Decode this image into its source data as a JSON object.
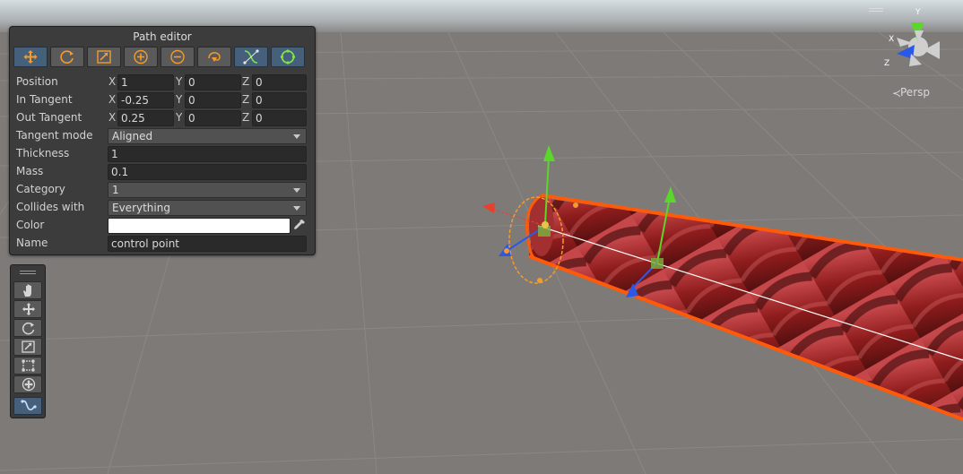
{
  "panel": {
    "title": "Path editor",
    "tools": [
      {
        "icon": "move-icon",
        "active": true
      },
      {
        "icon": "rotate-icon",
        "active": false
      },
      {
        "icon": "scale-icon",
        "active": false
      },
      {
        "icon": "add-point-icon",
        "active": false
      },
      {
        "icon": "remove-point-icon",
        "active": false
      },
      {
        "icon": "orient-icon",
        "active": false
      },
      {
        "icon": "tangent-icon",
        "active": true
      },
      {
        "icon": "thickness-icon",
        "active": true
      }
    ],
    "position": {
      "label": "Position",
      "x": "1",
      "y": "0",
      "z": "0"
    },
    "in_tangent": {
      "label": "In Tangent",
      "x": "-0.25",
      "y": "0",
      "z": "0"
    },
    "out_tangent": {
      "label": "Out Tangent",
      "x": "0.25",
      "y": "0",
      "z": "0"
    },
    "axis_labels": {
      "x": "X",
      "y": "Y",
      "z": "Z"
    },
    "tangent_mode": {
      "label": "Tangent mode",
      "value": "Aligned"
    },
    "thickness": {
      "label": "Thickness",
      "value": "1"
    },
    "mass": {
      "label": "Mass",
      "value": "0.1"
    },
    "category": {
      "label": "Category",
      "value": "1"
    },
    "collides_with": {
      "label": "Collides with",
      "value": "Everything"
    },
    "color": {
      "label": "Color",
      "value": "#ffffff"
    },
    "name": {
      "label": "Name",
      "value": "control point"
    }
  },
  "tools_overlay": [
    "hand-icon",
    "move-icon",
    "rotate-icon",
    "scale-icon",
    "rect-icon",
    "transform-icon",
    "path-icon"
  ],
  "tools_overlay_active": "path-icon",
  "gizmo": {
    "axes": {
      "x": "X",
      "y": "Y",
      "z": "Z"
    },
    "projection": "Persp"
  },
  "colors": {
    "accent": "#46607c",
    "rope_outline": "#ff5a0a",
    "rope": "#8e1c1c",
    "x_axis": "#e8402a",
    "y_axis": "#5bd62a",
    "z_axis": "#2a58e8"
  }
}
